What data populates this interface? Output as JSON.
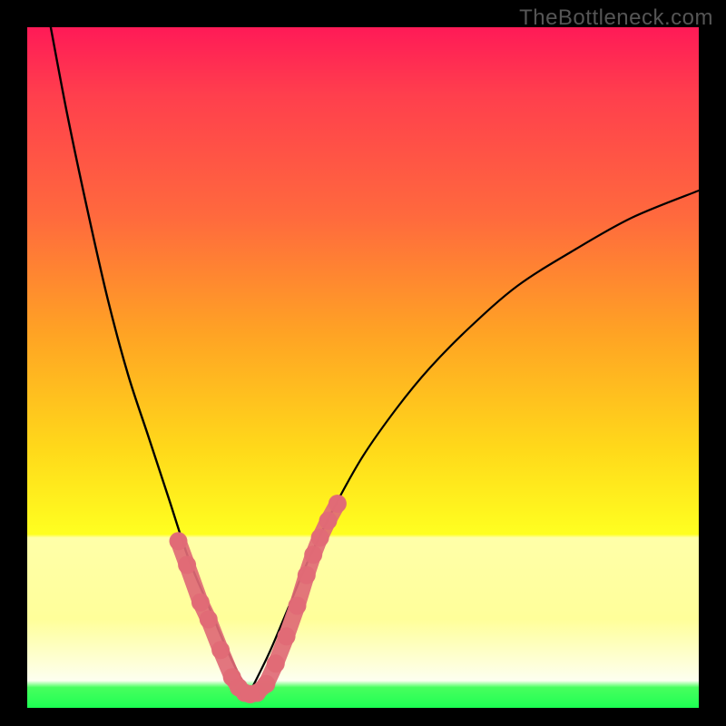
{
  "watermark": "TheBottleneck.com",
  "chart_data": {
    "type": "line",
    "title": "",
    "xlabel": "",
    "ylabel": "",
    "xlim": [
      0,
      100
    ],
    "ylim": [
      0,
      100
    ],
    "grid": false,
    "legend": false,
    "note": "Axes are unlabeled in the source image. x and y are normalized 0-100 across the visible plot area. Two black curve segments form a V with vertex near x≈33. Pink overlay beads trace the bottom of the V.",
    "series": [
      {
        "name": "left-branch",
        "stroke": "#000000",
        "x": [
          3.5,
          6,
          9,
          12,
          15,
          18,
          21,
          24,
          27,
          30,
          33
        ],
        "y": [
          100,
          87,
          73,
          60,
          49,
          40,
          31,
          22,
          15,
          8,
          2
        ]
      },
      {
        "name": "right-branch",
        "stroke": "#000000",
        "x": [
          33,
          36,
          39,
          42,
          46,
          50,
          55,
          60,
          66,
          73,
          81,
          90,
          100
        ],
        "y": [
          2,
          8,
          15,
          22,
          30,
          37,
          44,
          50,
          56,
          62,
          67,
          72,
          76
        ]
      },
      {
        "name": "beads-left",
        "stroke": "#e06a76",
        "type": "scatter",
        "x": [
          22.5,
          23.8,
          25.8,
          27.0,
          28.8,
          30.5,
          31.5,
          32.4,
          33.2
        ],
        "y": [
          24.5,
          21.0,
          15.5,
          13.0,
          8.5,
          4.5,
          3.0,
          2.2,
          2.0
        ]
      },
      {
        "name": "beads-right",
        "stroke": "#e06a76",
        "type": "scatter",
        "x": [
          34.2,
          35.6,
          37.0,
          38.6,
          40.2,
          41.6,
          42.6,
          43.6,
          44.8,
          46.2
        ],
        "y": [
          2.2,
          3.5,
          6.5,
          10.5,
          15.0,
          19.5,
          22.5,
          25.0,
          27.5,
          30.0
        ]
      }
    ],
    "background_gradient": {
      "direction": "top-to-bottom",
      "stops": [
        {
          "pos": 0.0,
          "color": "#ff1a57"
        },
        {
          "pos": 0.28,
          "color": "#ff6a3d"
        },
        {
          "pos": 0.6,
          "color": "#ffd91a"
        },
        {
          "pos": 0.76,
          "color": "#ffffa8"
        },
        {
          "pos": 0.96,
          "color": "#fdfff0"
        },
        {
          "pos": 0.97,
          "color": "#47ff5e"
        },
        {
          "pos": 1.0,
          "color": "#1bff52"
        }
      ]
    }
  }
}
